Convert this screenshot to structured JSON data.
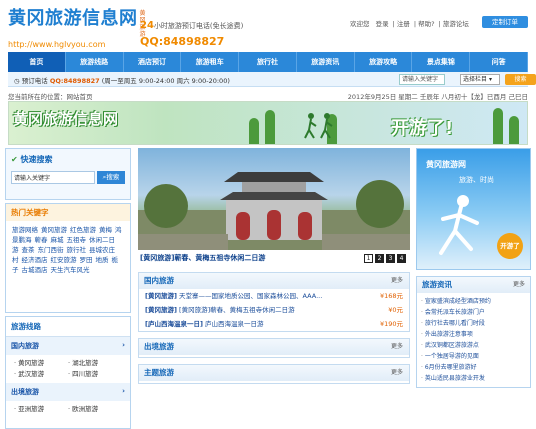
{
  "header": {
    "logo_text": "黄冈旅游信息网",
    "logo_sub": "黄冈旅游",
    "url": "http://www.hglvyou.com",
    "hotline_prefix": "24",
    "hotline_text": "小时旅游预订电话(免长途费)",
    "qq": "QQ:84898827",
    "top_links": [
      "欢迎您",
      "登录",
      "注册",
      "帮助?",
      "旅游论坛"
    ],
    "subscribe_button": "定制订单"
  },
  "nav": {
    "items": [
      "首页",
      "旅游线路",
      "酒店预订",
      "旅游租车",
      "旅行社",
      "旅游资讯",
      "旅游攻略",
      "景点集锦",
      "问答"
    ],
    "active": 0
  },
  "subbar": {
    "phone_label": "预订电话",
    "phone_value": "QQ:84898827",
    "hours": "(周一至周五 9:00-24:00 周六 9:00-20:00)",
    "search_placeholder": "请输入关键字",
    "select_value": "选择栏目",
    "search_button": "搜索"
  },
  "crumb": {
    "text": "您当前所在的位置：网站首页",
    "date": "2012年9月25日 星期二 壬辰年 八月初十【龙】已酉月 己巳日"
  },
  "banner": {
    "title": "黄冈旅游信息网",
    "slogan": "开游了!"
  },
  "quick_search": {
    "title": "快速搜索",
    "placeholder": "请输入关键字",
    "button": "搜索"
  },
  "hot": {
    "title": "热门关键字",
    "keywords": [
      "旅游网络",
      "黄冈旅游",
      "红色旅游",
      "黄梅",
      "鸿景鹏海",
      "蕲春",
      "麻城",
      "五祖寺",
      "休闲二日游",
      "查茶",
      "东门西街",
      "旅行社",
      "县城农庄村",
      "经济酒店",
      "红安旅游",
      "罗田",
      "地质",
      "栀子",
      "古城酒店",
      "天生汽车风光"
    ]
  },
  "routes": {
    "title": "旅游线路",
    "cats": [
      {
        "name": "国内旅游",
        "items": [
          "黄冈旅游",
          "湖北旅游",
          "武汉旅游",
          "四川旅游"
        ]
      },
      {
        "name": "出境旅游",
        "items": [
          "亚洲旅游",
          "欧洲旅游"
        ]
      }
    ]
  },
  "photo": {
    "caption": "[黄冈旅游]蕲春、黄梅五祖寺休闲二日游",
    "nums": [
      "1",
      "2",
      "3",
      "4"
    ],
    "active_num": 0
  },
  "sections": [
    {
      "title": "国内旅游",
      "more": "更多",
      "rows": [
        {
          "tag": "[黄冈旅游]",
          "text": "天堂寨——国家地质公园、国家森林公园、AAA...",
          "price": "¥168元"
        },
        {
          "tag": "[黄冈旅游]",
          "text": "[黄冈旅游]蕲春、黄梅五祖寺休闲二日游",
          "price": "¥0元"
        },
        {
          "tag": "[庐山西海温泉一日]",
          "text": "庐山西海温泉一日游",
          "price": "¥190元"
        }
      ]
    },
    {
      "title": "出境旅游",
      "more": "更多",
      "rows": []
    },
    {
      "title": "主题旅游",
      "more": "更多",
      "rows": []
    }
  ],
  "ad": {
    "title": "黄冈旅游网",
    "subtitle": "旅游、时尚",
    "go": "开游了"
  },
  "news": {
    "title": "旅游资讯",
    "more": "更多",
    "items": [
      "宣家盛滨成经型酒店预约",
      "会常托派车长旅游门户",
      "旅行社去哪儿看门时段",
      "外出旅游注意事项",
      "武汉铜都区游旅游点",
      "一个独居导游的见面",
      "6月份去哪里旅游好",
      "英山适民县旅游业开发"
    ]
  }
}
